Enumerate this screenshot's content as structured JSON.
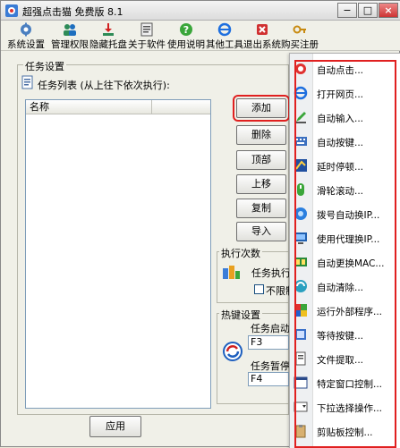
{
  "window": {
    "title": "超强点击猫 免费版 8.1",
    "minimize": "−",
    "maximize": "□",
    "close": "×"
  },
  "toolbar": {
    "items": [
      {
        "label": "系统设置",
        "icon": "gear-icon"
      },
      {
        "label": "管理权限",
        "icon": "users-icon"
      },
      {
        "label": "隐藏托盘",
        "icon": "tray-icon"
      },
      {
        "label": "关于软件",
        "icon": "info-icon"
      },
      {
        "label": "使用说明",
        "icon": "help-icon"
      },
      {
        "label": "其他工具",
        "icon": "ie-icon"
      },
      {
        "label": "退出系统",
        "icon": "exit-icon"
      },
      {
        "label": "购买注册",
        "icon": "key-icon"
      }
    ]
  },
  "task_settings": {
    "group_title": "任务设置",
    "list_caption": "任务列表 (从上往下依次执行):",
    "column_name": "名称",
    "buttons": {
      "add": "添加",
      "delete": "删除",
      "top": "顶部",
      "up": "上移",
      "copy": "复制",
      "import": "导入"
    }
  },
  "exec_count": {
    "group_title": "执行次数",
    "label": "任务执行",
    "unlimited": "不限制"
  },
  "hotkeys": {
    "group_title": "热键设置",
    "start_label": "任务启动",
    "start_value": "F3",
    "pause_label": "任务暂停",
    "pause_value": "F4"
  },
  "apply_button": "应用",
  "menu": {
    "items": [
      {
        "label": "自动点击...",
        "icon": "click-icon"
      },
      {
        "label": "打开网页...",
        "icon": "ie-icon"
      },
      {
        "label": "自动输入...",
        "icon": "pen-icon"
      },
      {
        "label": "自动按键...",
        "icon": "keyboard-icon"
      },
      {
        "label": "延时停顿...",
        "icon": "delay-icon"
      },
      {
        "label": "滑轮滚动...",
        "icon": "scroll-icon"
      },
      {
        "label": "拨号自动换IP...",
        "icon": "dial-icon"
      },
      {
        "label": "使用代理换IP...",
        "icon": "proxy-icon"
      },
      {
        "label": "自动更换MAC...",
        "icon": "mac-icon"
      },
      {
        "label": "自动清除...",
        "icon": "clean-icon"
      },
      {
        "label": "运行外部程序...",
        "icon": "run-icon"
      },
      {
        "label": "等待按键...",
        "icon": "wait-key-icon"
      },
      {
        "label": "文件提取...",
        "icon": "file-extract-icon"
      },
      {
        "label": "特定窗口控制...",
        "icon": "window-control-icon"
      },
      {
        "label": "下拉选择操作...",
        "icon": "dropdown-icon"
      },
      {
        "label": "剪贴板控制...",
        "icon": "clipboard-icon"
      }
    ]
  }
}
